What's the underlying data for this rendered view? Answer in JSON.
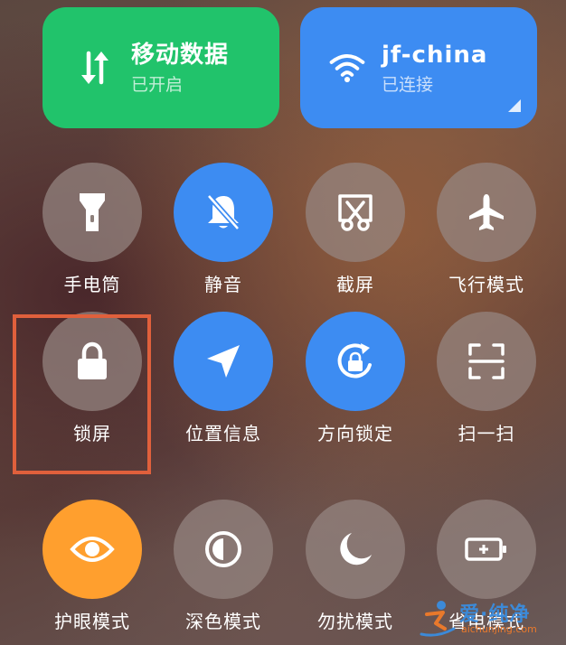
{
  "tiles": {
    "mobile_data": {
      "title": "移动数据",
      "status": "已开启",
      "icon": "mobile-data-arrows-icon",
      "color": "#21c36b"
    },
    "wifi": {
      "title": "jf-china",
      "status": "已连接",
      "icon": "wifi-icon",
      "color": "#3d8cf2"
    }
  },
  "toggles": [
    {
      "label": "手电筒",
      "icon": "flashlight-icon",
      "state": "off"
    },
    {
      "label": "静音",
      "icon": "bell-muted-icon",
      "state": "on"
    },
    {
      "label": "截屏",
      "icon": "screenshot-scissors-icon",
      "state": "off"
    },
    {
      "label": "飞行模式",
      "icon": "airplane-icon",
      "state": "off"
    },
    {
      "label": "锁屏",
      "icon": "lock-icon",
      "state": "off"
    },
    {
      "label": "位置信息",
      "icon": "location-arrow-icon",
      "state": "on"
    },
    {
      "label": "方向锁定",
      "icon": "rotation-lock-icon",
      "state": "on"
    },
    {
      "label": "扫一扫",
      "icon": "scan-icon",
      "state": "off"
    },
    {
      "label": "护眼模式",
      "icon": "eye-icon",
      "state": "on"
    },
    {
      "label": "深色模式",
      "icon": "dark-mode-icon",
      "state": "off"
    },
    {
      "label": "勿扰模式",
      "icon": "moon-icon",
      "state": "off"
    },
    {
      "label": "省电模式",
      "icon": "battery-saver-icon",
      "state": "off"
    }
  ],
  "colors": {
    "active_blue": "#3d8cf2",
    "active_green": "#21c36b",
    "active_orange": "#ff9f2e",
    "highlight": "#e0603c"
  },
  "watermark": {
    "text": "爱·纯净",
    "url": "aichunjing.com"
  }
}
